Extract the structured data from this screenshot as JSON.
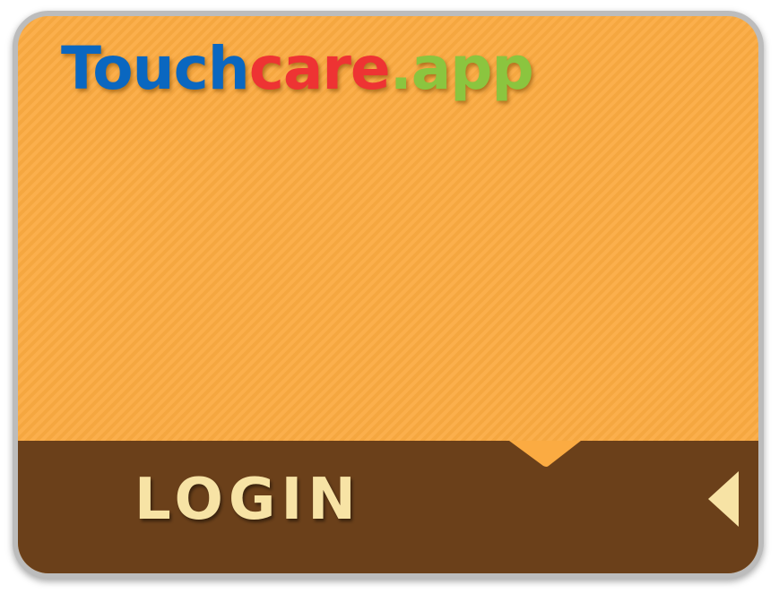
{
  "logo": {
    "part1": "Touch",
    "part2": "care",
    "part3": ".app"
  },
  "footer": {
    "login_label": "LOGIN",
    "arrow_icon": "triangle-left-icon"
  },
  "colors": {
    "tile_background": "#fbab42",
    "footer_background": "#6b401a",
    "logo_blue": "#0a67c0",
    "logo_red": "#ee3333",
    "logo_green": "#8bc53f",
    "login_text": "#f7e3a5"
  }
}
